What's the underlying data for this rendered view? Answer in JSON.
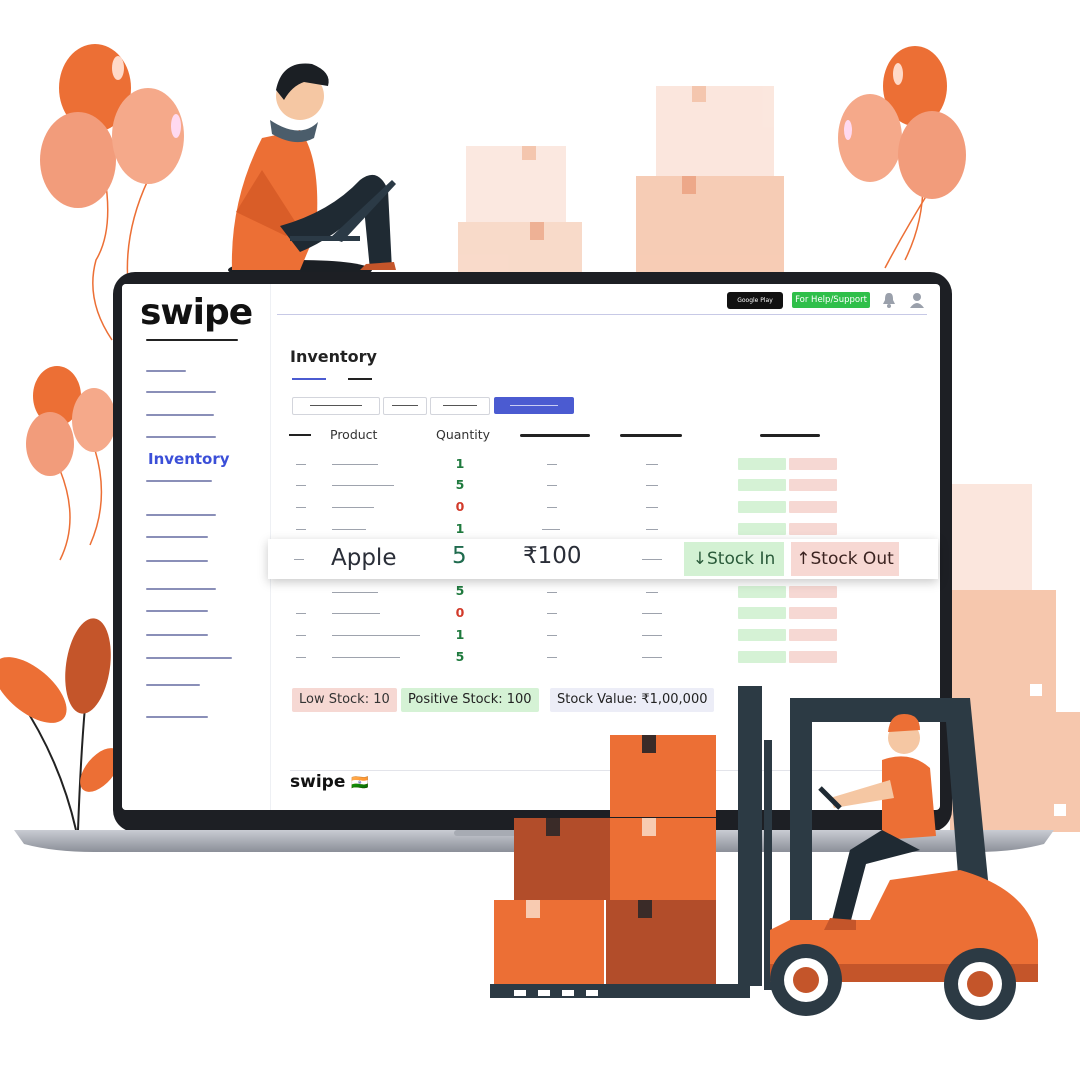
{
  "brand": {
    "logo_text": "swipe",
    "footer_logo": "swipe",
    "footer_flag": "🇮🇳"
  },
  "topbar": {
    "google_play_small": "GET IT ON",
    "google_play": "Google Play",
    "help_button": "For Help/Support",
    "bell_icon": "bell-icon",
    "user_icon": "user-icon"
  },
  "sidebar": {
    "active_item": "Inventory"
  },
  "page": {
    "title": "Inventory"
  },
  "table": {
    "headers": [
      "Product",
      "Quantity"
    ],
    "quantities": [
      "1",
      "5",
      "0",
      "1",
      "",
      "5",
      "0",
      "1",
      "5"
    ],
    "highlight": {
      "product": "Apple",
      "quantity": "5",
      "price": "₹100",
      "stock_in": "Stock In",
      "stock_out": "Stock Out",
      "stock_in_icon": "arrow-down-icon",
      "stock_out_icon": "arrow-up-icon"
    }
  },
  "stats": {
    "low_stock": "Low Stock: 10",
    "positive_stock": "Positive Stock: 100",
    "stock_value": "Stock Value: ₹1,00,000"
  },
  "colors": {
    "accent": "#4b5bd1",
    "positive": "#1f7a3e",
    "negative": "#d23a2a",
    "illustration_orange": "#ec6f35",
    "box_peach": "#f6c7ad"
  }
}
